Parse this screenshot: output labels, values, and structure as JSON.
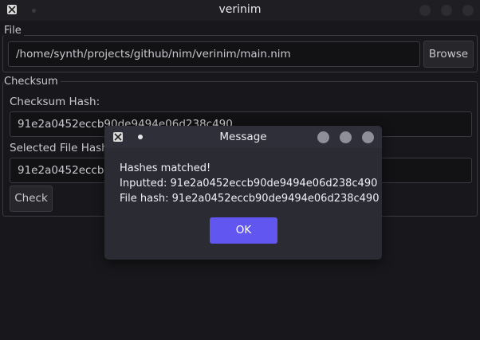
{
  "window": {
    "title": "verinim"
  },
  "file_group": {
    "legend": "File",
    "path_value": "/home/synth/projects/github/nim/verinim/main.nim",
    "browse_label": "Browse"
  },
  "checksum_group": {
    "legend": "Checksum",
    "checksum_hash_label": "Checksum Hash:",
    "checksum_hash_value": "91e2a0452eccb90de9494e06d238c490",
    "selected_file_hash_label": "Selected File Hash:",
    "selected_file_hash_value": "91e2a0452eccb90de9494e06d238c490",
    "check_label": "Check"
  },
  "dialog": {
    "title": "Message",
    "line1": "Hashes matched!",
    "line2": "Inputted: 91e2a0452eccb90de9494e06d238c490",
    "line3": "File hash: 91e2a0452eccb90de9494e06d238c490",
    "ok_label": "OK"
  },
  "colors": {
    "accent": "#6157f0",
    "background": "#18181c",
    "dialog_background": "#2b2b34"
  }
}
